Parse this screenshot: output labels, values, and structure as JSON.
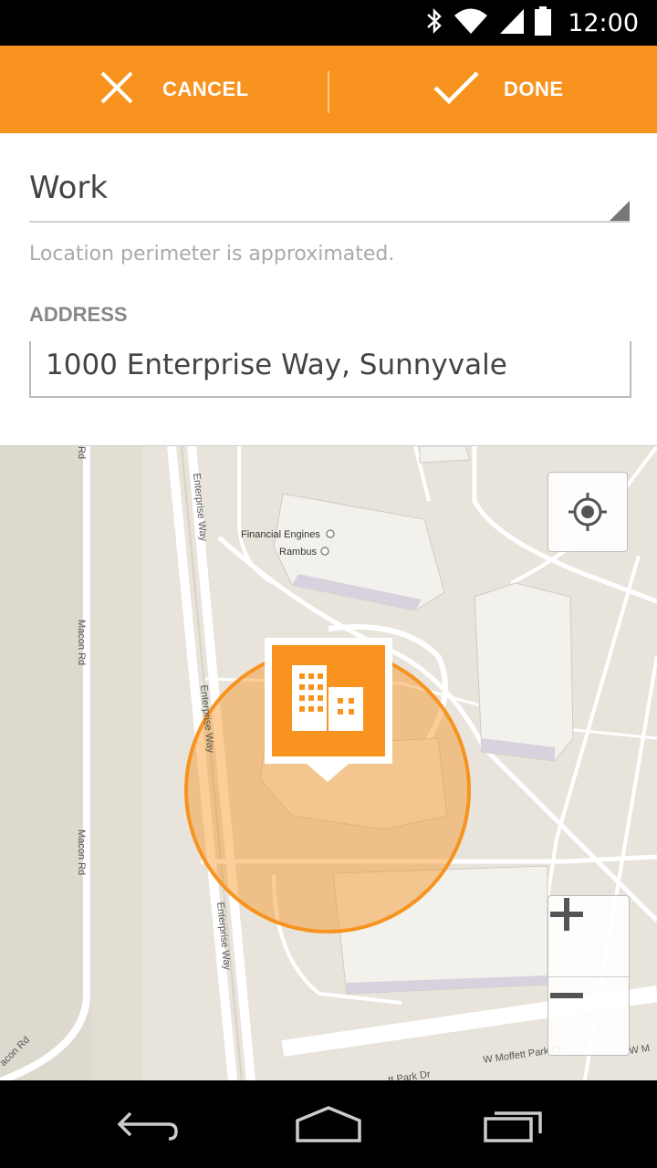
{
  "status_bar": {
    "time": "12:00",
    "icons": [
      "bluetooth-icon",
      "wifi-icon",
      "signal-icon",
      "battery-icon"
    ]
  },
  "action_bar": {
    "cancel_label": "CANCEL",
    "done_label": "DONE",
    "color": "#f7931e"
  },
  "form": {
    "place_name": "Work",
    "helper_text": "Location perimeter is approximated.",
    "address_label": "ADDRESS",
    "address_value": "1000 Enterprise Way, Sunnyvale"
  },
  "map": {
    "streets": {
      "enterprise_way": "Enterprise Way",
      "macon_rd": "Macon Rd",
      "w_moffett_park_dr": "W Moffett Park Dr",
      "w_moffett_park_dr_partial": "W M",
      "park_dr_partial": "tt Park Dr",
      "macon_rd_partial": "acon Rd",
      "rd_partial": "Rd"
    },
    "pois": [
      "Financial Engines",
      "Rambus"
    ],
    "marker_icon": "building-icon",
    "perimeter_color": "#f7931e"
  },
  "nav_bar": {
    "icons": [
      "back-icon",
      "home-icon",
      "recents-icon"
    ]
  }
}
